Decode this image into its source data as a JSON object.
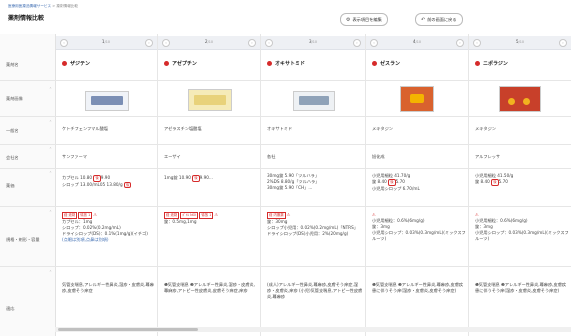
{
  "header": {
    "breadcrumb_home": "医療用医薬品情報サービス",
    "breadcrumb_sep": " > ",
    "breadcrumb_current": "薬剤情報比較",
    "title": "薬剤情報比較",
    "btn_show_items": "表示項目を編集",
    "btn_back": "前の画面に戻る"
  },
  "rows": [
    "薬剤名",
    "薬剤画像",
    "一般名",
    "会社名",
    "薬価",
    "規格・剤形・容量",
    "適応"
  ],
  "columns": [
    {
      "page": "1",
      "total": "/10",
      "name": "ザジテン",
      "generic": "ケトチフェンフマル酸塩",
      "company": "サンファーマ",
      "price": [
        "カプセル  10.80  ",
        "後",
        "9.90",
        "シロップ  13.00/mL05  13.80/g  ",
        "後"
      ],
      "spec_tags": [
        "経 液剤",
        "徐放 1"
      ],
      "spec": [
        "カプセル：1mg",
        "シロップ：0.02%(0.2mg/mL)",
        "ドライシロップ(DS)：0.1%(1mg/g)(イチゴ)",
        "(点眼は別項,点鼻は別項)"
      ],
      "indication": "気管支喘息,アレルギー性鼻炎,湿疹・皮膚炎,蕁麻疹,皮膚そう痒症",
      "img": "#7b8fb5"
    },
    {
      "page": "2",
      "total": "/10",
      "name": "アゼプチン",
      "generic": "アゼラスチン塩酸塩",
      "company": "エーザイ",
      "price": [
        "1mg錠  10.90  ",
        "後",
        "9.90..."
      ],
      "spec_tags": [
        "経 液剤",
        "ﾎﾞﾄﾙ NOI",
        "徐放 1"
      ],
      "spec": [
        "錠：0.5mg,1mg"
      ],
      "indication": "❶気管支喘息 ❷アレルギー性鼻炎,湿疹・皮膚炎,蕁麻疹,アトピー性皮膚炎,皮膚そう痒症,痒疹",
      "img": "#e8d27a"
    },
    {
      "page": "3",
      "total": "/10",
      "name": "オキサトミド",
      "generic": "オキサトミド",
      "company": "各社",
      "price": [
        "30mg錠  5.90「ツルハラ」",
        "2%DS  8.80/g「ツルハラ」",
        "30mg錠  5.90「CH」..."
      ],
      "spec_tags": [
        "経 内服薬"
      ],
      "spec": [
        "錠：30mg",
        "シロップ小児用：0.02%(0.2mg/mL)「NTRS」",
        "ドライシロップ(DS)小児用：2%(20mg/g)"
      ],
      "indication": "(成人)アレルギー性鼻炎,蕁麻疹,皮膚そう痒症,湿疹・皮膚炎,痒疹 (小児)気管支喘息,アトピー性皮膚炎,蕁麻疹",
      "img": "#8fa2b8"
    },
    {
      "page": "4",
      "total": "/10",
      "name": "ゼスラン",
      "generic": "メキタジン",
      "company": "旭化成",
      "price": [
        "小児用細粒  41.70/g",
        "錠  8.40  ",
        "後",
        "5.70",
        "小児用シロップ  6.70/mL"
      ],
      "spec_tags": [],
      "spec": [
        "小児用細粒：0.6%(6mg/g)",
        "錠：3mg",
        "小児用シロップ：0.03%(0.3mg/mL)(ミックスフルーツ)"
      ],
      "indication": "❶気管支喘息 ❷アレルギー性鼻炎,蕁麻疹,皮膚疾患に伴うそう痒(湿疹・皮膚炎,皮膚そう痒症)",
      "img": "#d9622e"
    },
    {
      "page": "5",
      "total": "/10",
      "name": "ニポラジン",
      "generic": "メキタジン",
      "company": "アルフレッサ",
      "price": [
        "小児用細粒  41.50/g",
        "錠  8.40  ",
        "後",
        "5.70"
      ],
      "spec_tags": [],
      "spec": [
        "小児用細粒：0.6%(6mg/g)",
        "錠：3mg",
        "小児用シロップ：0.03%(0.3mg/mL)(ミックスフルーツ)"
      ],
      "indication": "❶気管支喘息 ❷アレルギー性鼻炎,蕁麻疹,皮膚疾患に伴うそう痒(湿疹・皮膚炎,皮膚そう痒症)",
      "img": "#c8402a"
    }
  ],
  "colors": {
    "accent": "#d62b2b",
    "link": "#3a6ab0"
  }
}
